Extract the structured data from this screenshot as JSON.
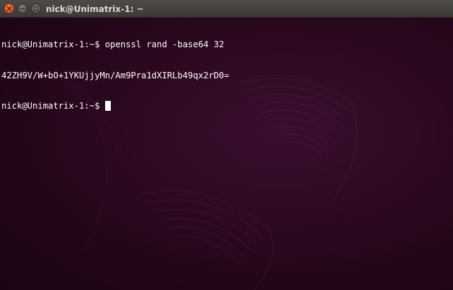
{
  "window": {
    "title": "nick@Unimatrix-1: ~",
    "buttons": {
      "close_icon": "close-icon",
      "minimize_icon": "minimize-icon",
      "maximize_icon": "maximize-icon"
    }
  },
  "terminal": {
    "lines": [
      {
        "prompt": "nick@Unimatrix-1:~$",
        "command": "openssl rand -base64 32"
      },
      {
        "output": "42ZH9V/W+bO+1YKUjjyMn/Am9Pra1dXIRLb49qx2rD0="
      },
      {
        "prompt": "nick@Unimatrix-1:~$",
        "command": ""
      }
    ]
  },
  "colors": {
    "terminal_bg": "#2d0922",
    "text": "#ffffff",
    "titlebar": "#3c3b37",
    "close_button": "#df4a1b"
  }
}
